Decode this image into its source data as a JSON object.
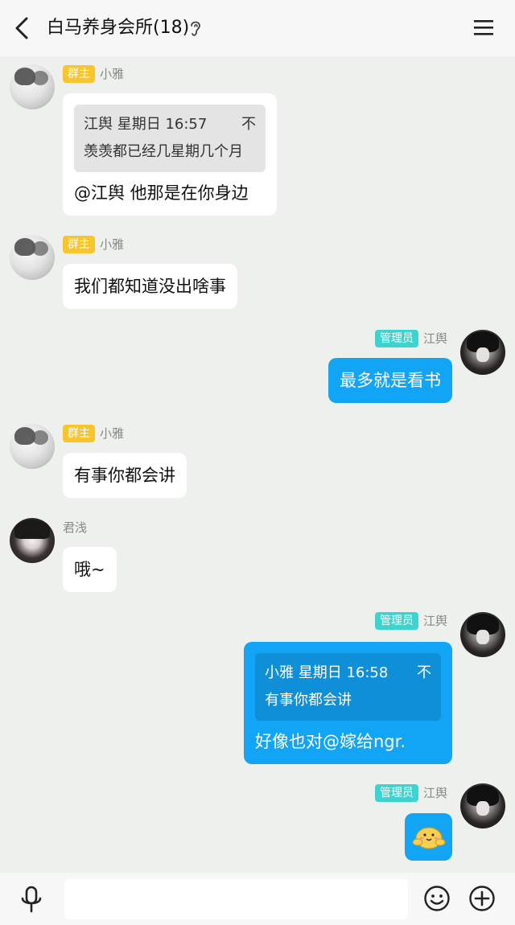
{
  "header": {
    "title": "白马养身会所(18)"
  },
  "messages": [
    {
      "sender": "小雅",
      "badge": "群主",
      "quote": {
        "from": "江舆 星期日 16:57",
        "icon": "不",
        "text": "羡羡都已经几星期几个月"
      },
      "text": "@江舆 他那是在你身边"
    },
    {
      "sender": "小雅",
      "badge": "群主",
      "text": "我们都知道没出啥事"
    },
    {
      "sender": "江舆",
      "badge": "管理员",
      "text": "最多就是看书"
    },
    {
      "sender": "小雅",
      "badge": "群主",
      "text": "有事你都会讲"
    },
    {
      "sender": "君浅",
      "text": "哦~"
    },
    {
      "sender": "江舆",
      "badge": "管理员",
      "quote": {
        "from": "小雅 星期日 16:58",
        "icon": "不",
        "text": "有事你都会讲"
      },
      "text": "好像也对@嫁给ngr."
    },
    {
      "sender": "江舆",
      "badge": "管理员",
      "sticker": "hug-sticker"
    }
  ],
  "colors": {
    "owner_badge": "#f8c52c",
    "admin_badge": "#3fd3cf",
    "my_bubble": "#12a5f5",
    "background": "#edf0ec"
  },
  "icons": [
    "back-icon",
    "ear-icon",
    "menu-icon",
    "mic-icon",
    "emoji-icon",
    "plus-icon"
  ]
}
